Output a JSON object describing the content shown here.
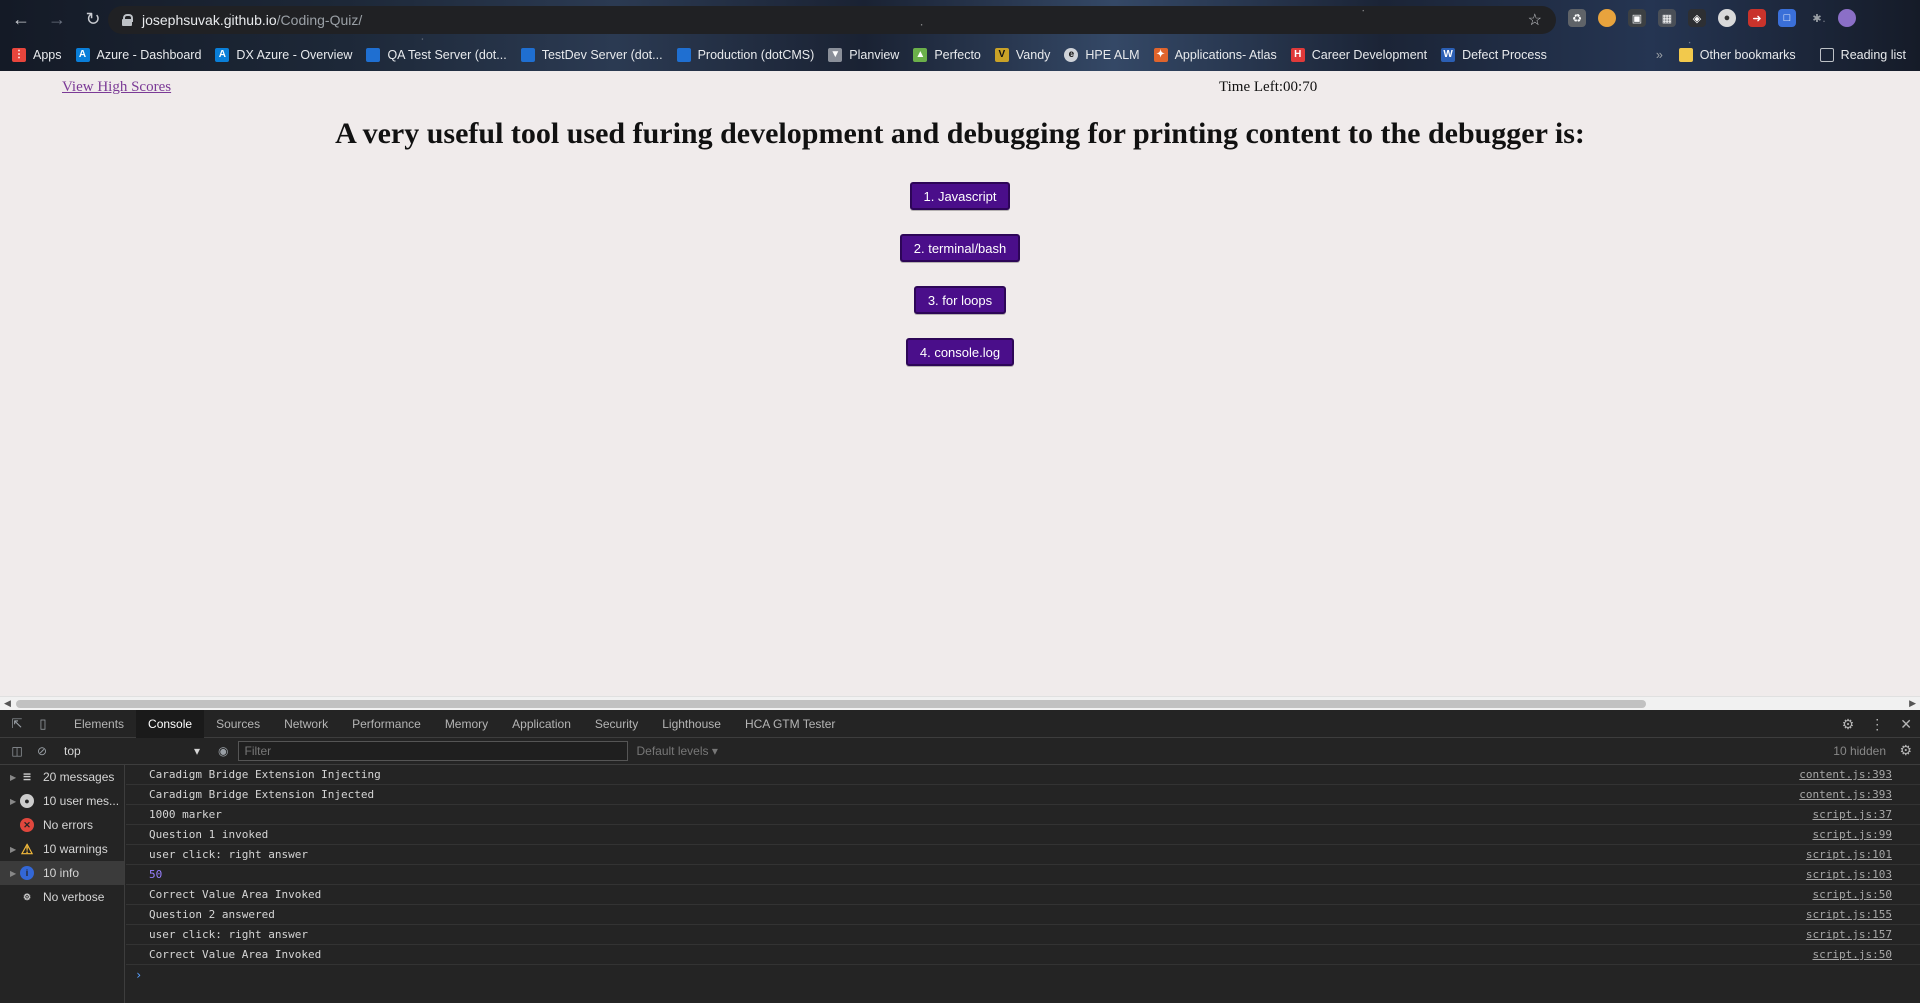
{
  "browser": {
    "url_host": "josephsuvak.github.io",
    "url_path": "/Coding-Quiz/",
    "bookmarks": [
      {
        "label": "Apps",
        "icon": "apps-grid-icon",
        "color": "#e8453c"
      },
      {
        "label": "Azure - Dashboard",
        "icon": "azure-icon",
        "color": "#0a7fd9"
      },
      {
        "label": "DX Azure - Overview",
        "icon": "azure-icon",
        "color": "#0a7fd9"
      },
      {
        "label": "QA Test Server (dot...",
        "icon": "server-icon",
        "color": "#1f6fd1"
      },
      {
        "label": "TestDev Server (dot...",
        "icon": "server-icon",
        "color": "#1f6fd1"
      },
      {
        "label": "Production (dotCMS)",
        "icon": "server-icon",
        "color": "#1f6fd1"
      },
      {
        "label": "Planview",
        "icon": "planview-icon",
        "color": "#8a8f99"
      },
      {
        "label": "Perfecto",
        "icon": "perfecto-icon",
        "color": "#6bb04a"
      },
      {
        "label": "Vandy",
        "icon": "vandy-icon",
        "color": "#c9a227"
      },
      {
        "label": "HPE ALM",
        "icon": "hpe-icon",
        "color": "#cfd3d9"
      },
      {
        "label": "Applications- Atlas",
        "icon": "atlas-icon",
        "color": "#e0642c"
      },
      {
        "label": "Career Development",
        "icon": "career-icon",
        "color": "#e03a3a"
      },
      {
        "label": "Defect Process",
        "icon": "word-icon",
        "color": "#2b5fb4"
      }
    ],
    "other_bookmarks": "Other bookmarks",
    "reading_list": "Reading list"
  },
  "page": {
    "high_scores_link": "View High Scores",
    "timer": "Time Left:00:70",
    "question": "A very useful tool used furing development and debugging for printing content to the debugger is:",
    "answers": [
      "1. Javascript",
      "2. terminal/bash",
      "3. for loops",
      "4. console.log"
    ]
  },
  "devtools": {
    "tabs": [
      "Elements",
      "Console",
      "Sources",
      "Network",
      "Performance",
      "Memory",
      "Application",
      "Security",
      "Lighthouse",
      "HCA GTM Tester"
    ],
    "active_tab": "Console",
    "context": "top",
    "filter_placeholder": "Filter",
    "levels": "Default levels ▾",
    "hidden": "10 hidden",
    "sidebar": [
      {
        "label": "20 messages",
        "icon": "list-icon"
      },
      {
        "label": "10 user mes...",
        "icon": "user-icon"
      },
      {
        "label": "No errors",
        "icon": "error-icon"
      },
      {
        "label": "10 warnings",
        "icon": "warning-icon"
      },
      {
        "label": "10 info",
        "icon": "info-icon"
      },
      {
        "label": "No verbose",
        "icon": "verbose-icon"
      }
    ],
    "log": [
      {
        "message": "Caradigm Bridge Extension Injecting",
        "source": "content.js:393"
      },
      {
        "message": "Caradigm Bridge Extension Injected",
        "source": "content.js:393"
      },
      {
        "message": "1000 marker",
        "source": "script.js:37"
      },
      {
        "message": "Question 1 invoked",
        "source": "script.js:99"
      },
      {
        "message": "user click: right answer",
        "source": "script.js:101"
      },
      {
        "message": "50",
        "source": "script.js:103"
      },
      {
        "message": "Correct Value Area Invoked",
        "source": "script.js:50"
      },
      {
        "message": "Question 2 answered",
        "source": "script.js:155"
      },
      {
        "message": "user click: right answer",
        "source": "script.js:157"
      },
      {
        "message": "Correct Value Area Invoked",
        "source": "script.js:50"
      }
    ]
  }
}
